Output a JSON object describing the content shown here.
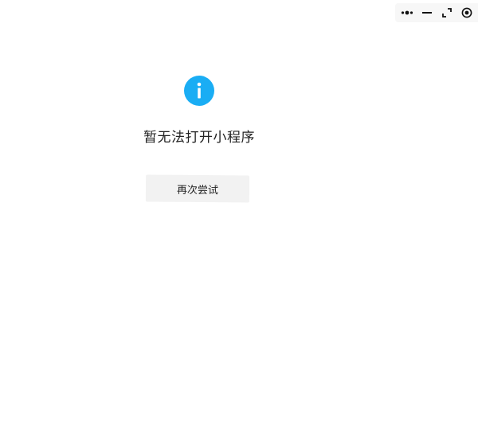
{
  "capsule": {
    "more_icon": "more-dots-icon",
    "minimize_icon": "minimize-icon",
    "fullscreen_icon": "fullscreen-icon",
    "close_icon": "close-circle-icon"
  },
  "main": {
    "status_icon": "info-icon",
    "status_icon_color": "#1aadf4",
    "message": "暂无法打开小程序",
    "retry_label": "再次尝试"
  }
}
